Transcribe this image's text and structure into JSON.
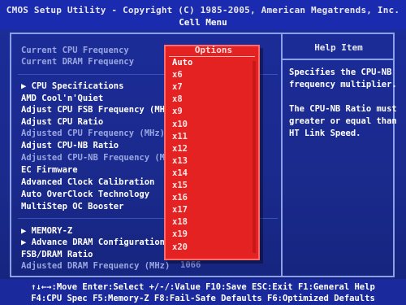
{
  "header": {
    "title": "CMOS Setup Utility - Copyright (C) 1985-2005, American Megatrends, Inc.",
    "subtitle": "Cell Menu"
  },
  "left_items": [
    {
      "label": "Current CPU Frequency",
      "dim": true
    },
    {
      "label": "Current DRAM Frequency",
      "dim": true
    },
    {
      "label": "▶ CPU Specifications",
      "dim": false
    },
    {
      "label": "AMD Cool'n'Quiet",
      "dim": false
    },
    {
      "label": "Adjust CPU FSB Frequency (MH",
      "dim": false
    },
    {
      "label": "Adjust CPU Ratio",
      "dim": false
    },
    {
      "label": "Adjusted CPU Frequency (MHz)",
      "dim": true
    },
    {
      "label": "Adjust CPU-NB Ratio",
      "dim": false
    },
    {
      "label": "Adjusted CPU-NB Frequency (M",
      "dim": true
    },
    {
      "label": "EC Firmware",
      "dim": false
    },
    {
      "label": "Advanced Clock Calibration",
      "dim": false
    },
    {
      "label": "Auto OverClock Technology",
      "dim": false
    },
    {
      "label": "MultiStep OC Booster",
      "dim": false
    },
    {
      "label": "▶ MEMORY-Z",
      "dim": false
    },
    {
      "label": "▶ Advance DRAM Configuration",
      "dim": false
    },
    {
      "label": "FSB/DRAM Ratio",
      "dim": false
    },
    {
      "label": "Adjusted DRAM Frequency (MHz)",
      "dim": true
    }
  ],
  "adjusted_dram_value": "1066",
  "popup": {
    "title": "Options",
    "options": [
      "Auto",
      "x6",
      "x7",
      "x8",
      "x9",
      "x10",
      "x11",
      "x12",
      "x13",
      "x14",
      "x15",
      "x16",
      "x17",
      "x18",
      "x19",
      "x20"
    ],
    "selected_index": 0
  },
  "help": {
    "title": "Help Item",
    "text": "Specifies the CPU-NB\nfrequency multiplier.\n\nThe CPU-NB Ratio must\ngreater or equal than\nHT Link Speed."
  },
  "footer": {
    "line1": "↑↓←→:Move  Enter:Select  +/-/:Value  F10:Save  ESC:Exit  F1:General Help",
    "line2": "F4:CPU Spec  F5:Memory-Z  F8:Fail-Safe Defaults  F6:Optimized Defaults"
  },
  "colors": {
    "background": "#1a2a8a",
    "popup": "#e42222",
    "frame": "#8aa0e8"
  }
}
